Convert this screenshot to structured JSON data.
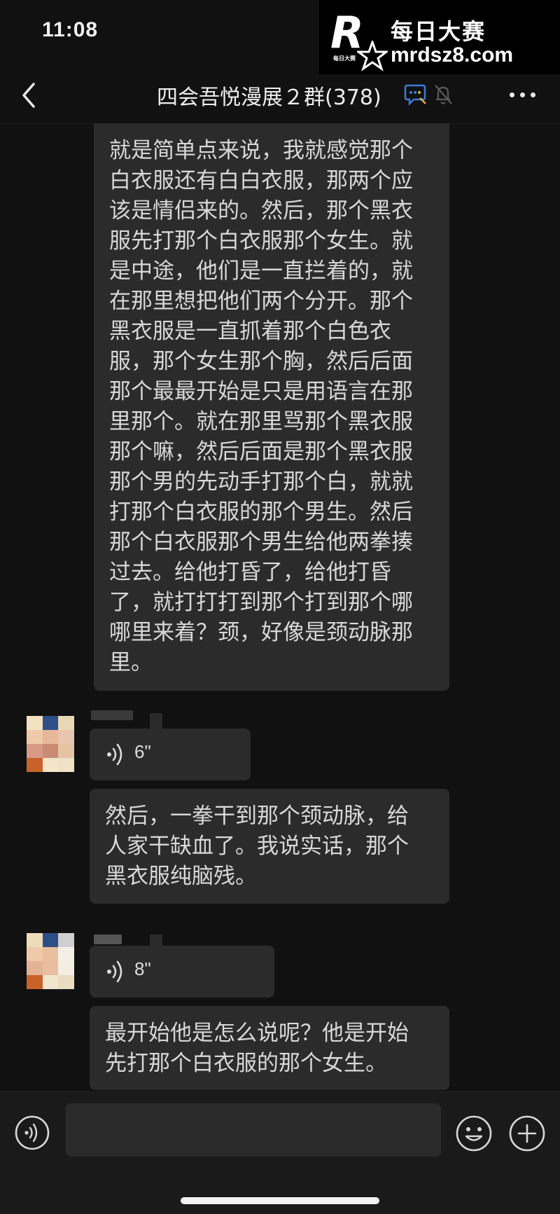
{
  "status_bar": {
    "time": "11:08"
  },
  "watermark": {
    "logo_letter": "R",
    "logo_small_text": "每日大赛",
    "name": "每日大赛",
    "url": "mrdsz8.com"
  },
  "header": {
    "title": "四会吾悦漫展２群(378)",
    "back_icon": "chevron-left-icon",
    "chat_icon": "chat-bubble-icon",
    "mute_icon": "bell-muted-icon",
    "more_icon": "more-horizontal-icon"
  },
  "messages": [
    {
      "type": "text",
      "text": "就是简单点来说，我就感觉那个\n白衣服还有白白衣服，那两个应\n该是情侣来的。然后，那个黑衣\n服先打那个白衣服那个女生。就\n是中途，他们是一直拦着的，就\n在那里想把他们两个分开。那个\n黑衣服是一直抓着那个白色衣\n服，那个女生那个胸，然后后面\n那个最最开始是只是用语言在那\n里那个。就在那里骂那个黑衣服\n那个嘛，然后后面是那个黑衣服\n那个男的先动手打那个白，就就\n打那个白衣服的那个男生。然后\n那个白衣服那个男生给他两拳揍\n过去。给他打昏了，给他打昏\n了，就打打打到那个打到那个哪\n哪里来着？颈，好像是颈动脉那\n里。"
    },
    {
      "type": "voice",
      "duration": "6\""
    },
    {
      "type": "text",
      "text": "然后，一拳干到那个颈动脉，给\n人家干缺血了。我说实话，那个\n黑衣服纯脑残。"
    },
    {
      "type": "voice",
      "duration": "8\""
    },
    {
      "type": "text",
      "text": "最开始他是怎么说呢？他是开始\n先打那个白衣服的那个女生。"
    }
  ],
  "input_bar": {
    "voice_icon": "voice-input-icon",
    "text_value": "",
    "emoji_icon": "emoji-icon",
    "plus_icon": "plus-icon"
  },
  "colors": {
    "background": "#111111",
    "bubble": "#2b2b2b",
    "text": "#d8d8d8",
    "input_bar": "#1a1a1a"
  }
}
